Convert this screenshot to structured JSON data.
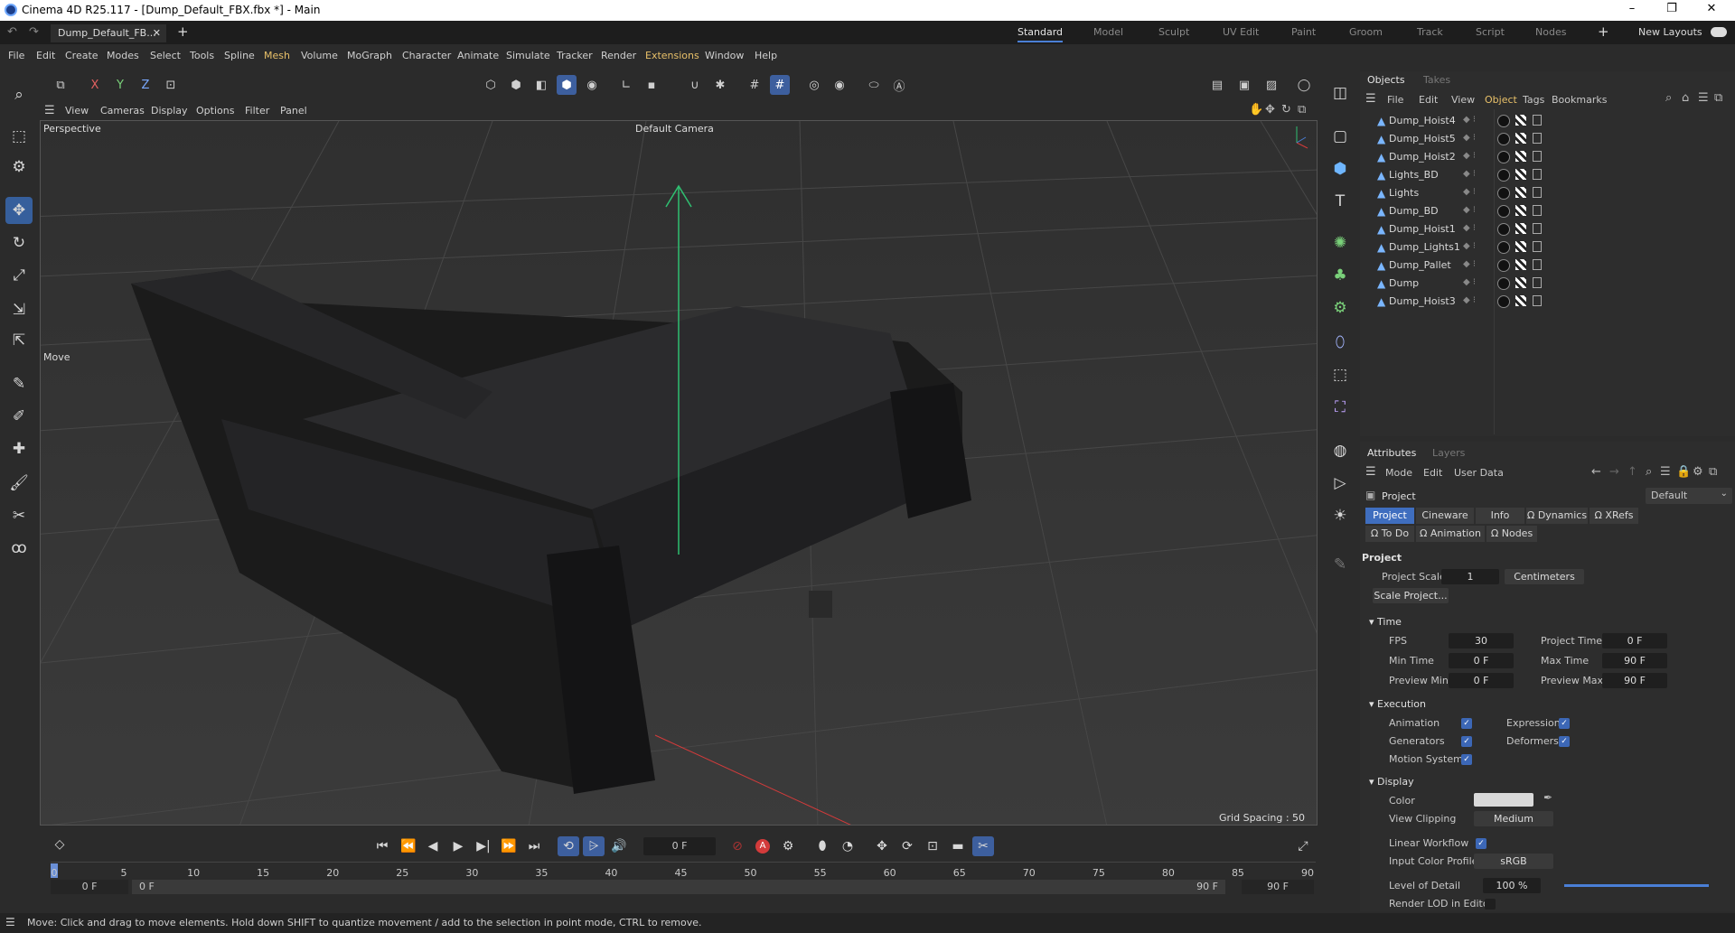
{
  "window": {
    "title": "Cinema 4D R25.117 - [Dump_Default_FBX.fbx *] - Main",
    "minimize": "–",
    "maximize": "❐",
    "close": "✕"
  },
  "tabbar": {
    "doc_tab": "Dump_Default_FB...",
    "doc_close": "✕",
    "add_tab": "+",
    "layouts": [
      "Standard",
      "Model",
      "Sculpt",
      "UV Edit",
      "Paint",
      "Groom",
      "Track",
      "Script",
      "Nodes"
    ],
    "active_layout": "Standard",
    "add_layout": "+",
    "new_layouts": "New Layouts"
  },
  "menubar": [
    "File",
    "Edit",
    "Create",
    "Modes",
    "Select",
    "Tools",
    "Spline",
    "Mesh",
    "Volume",
    "MoGraph",
    "Character",
    "Animate",
    "Simulate",
    "Tracker",
    "Render",
    "Extensions",
    "Window",
    "Help"
  ],
  "axis_toolbar": {
    "x": "X",
    "y": "Y",
    "z": "Z"
  },
  "viewport": {
    "menu": [
      "View",
      "Cameras",
      "Display",
      "Options",
      "Filter",
      "Panel"
    ],
    "projection": "Perspective",
    "camera": "Default Camera",
    "tool_label": "Move",
    "grid_spacing": "Grid Spacing : 50 cm"
  },
  "objects": {
    "tabs": [
      "Objects",
      "Takes"
    ],
    "menu": [
      "File",
      "Edit",
      "View",
      "Object",
      "Tags",
      "Bookmarks"
    ],
    "active_menu": "Object",
    "items": [
      "Dump_Hoist4",
      "Dump_Hoist5",
      "Dump_Hoist2",
      "Lights_BD",
      "Lights",
      "Dump_BD",
      "Dump_Hoist1",
      "Dump_Lights1",
      "Dump_Pallet",
      "Dump",
      "Dump_Hoist3"
    ]
  },
  "attributes": {
    "tabs": [
      "Attributes",
      "Layers"
    ],
    "menu": [
      "Mode",
      "Edit",
      "User Data"
    ],
    "object_label": "Project",
    "preset": "Default",
    "subtabs_row1": [
      "Project",
      "Cineware",
      "Info",
      "Ω Dynamics",
      "Ω XRefs"
    ],
    "subtabs_row2": [
      "Ω To Do",
      "Ω Animation",
      "Ω Nodes"
    ],
    "section_project": "Project",
    "project_scale_label": "Project Scale",
    "project_scale": "1",
    "project_units": "Centimeters",
    "scale_project": "Scale Project...",
    "time_section": "Time",
    "fps_label": "FPS",
    "fps": "30",
    "project_time_label": "Project Time",
    "project_time": "0 F",
    "min_time_label": "Min Time",
    "min_time": "0 F",
    "max_time_label": "Max Time",
    "max_time": "90 F",
    "preview_min_label": "Preview Min",
    "preview_min": "0 F",
    "preview_max_label": "Preview Max",
    "preview_max": "90 F",
    "execution_section": "Execution",
    "animation_label": "Animation",
    "expression_label": "Expression",
    "generators_label": "Generators",
    "deformers_label": "Deformers",
    "motion_system_label": "Motion System",
    "display_section": "Display",
    "color_label": "Color",
    "color_value": "#d9d9d9",
    "view_clipping_label": "View Clipping",
    "view_clipping": "Medium",
    "linear_workflow_label": "Linear Workflow",
    "input_color_profile_label": "Input Color Profile",
    "input_color_profile": "sRGB",
    "lod_label": "Level of Detail",
    "lod": "100 %",
    "lod_fraction": 1.0,
    "render_lod_label": "Render LOD in Editor"
  },
  "timeline": {
    "current_frame": "0 F",
    "ruler_ticks": [
      "0",
      "5",
      "10",
      "15",
      "20",
      "25",
      "30",
      "35",
      "40",
      "45",
      "50",
      "55",
      "60",
      "65",
      "70",
      "75",
      "80",
      "85",
      "90"
    ],
    "range_start": "0 F",
    "range_start2": "0 F",
    "range_end": "90 F",
    "range_end2": "90 F"
  },
  "status": "Move: Click and drag to move elements. Hold down SHIFT to quantize movement / add to the selection in point mode, CTRL to remove.",
  "colors": {
    "accent": "#3d5f9e",
    "y_axis": "#2fbf71",
    "x_axis": "#d33b3b",
    "highlight_menu": "#e8c069"
  }
}
